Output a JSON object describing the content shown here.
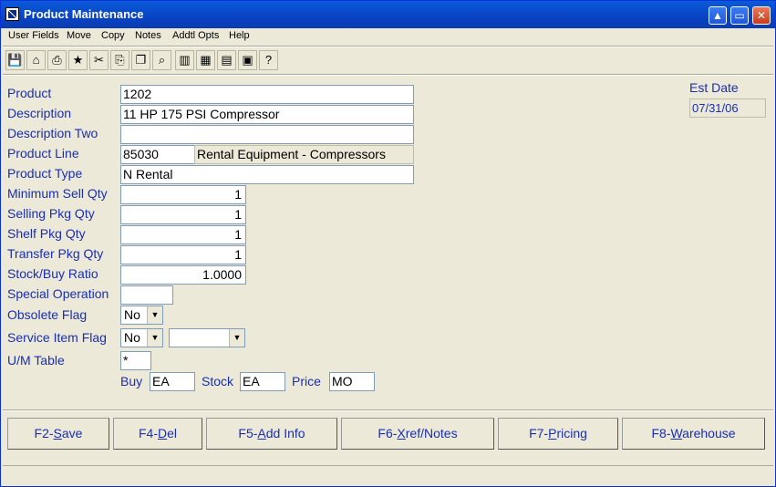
{
  "window": {
    "title": "Product Maintenance",
    "min_label": "▲",
    "max_label": "▭",
    "close_label": "✕"
  },
  "menu": [
    "User Fields",
    "Move",
    "Copy",
    "Notes",
    "Addtl Opts",
    "Help"
  ],
  "toolbar": [
    {
      "name": "save-icon",
      "glyph": "💾"
    },
    {
      "name": "clear-icon",
      "glyph": "⌂"
    },
    {
      "name": "print-icon",
      "glyph": "⎙"
    },
    {
      "name": "run-icon",
      "glyph": "★"
    },
    {
      "name": "cut-icon",
      "glyph": "✂"
    },
    {
      "name": "copy-icon",
      "glyph": "⎘"
    },
    {
      "name": "paste-icon",
      "glyph": "❐"
    },
    {
      "name": "find-icon",
      "glyph": "⌕"
    },
    {
      "name": "exit-door-icon",
      "glyph": "▥"
    },
    {
      "name": "bldg-icon",
      "glyph": "▦"
    },
    {
      "name": "calculator-icon",
      "glyph": "▤"
    },
    {
      "name": "calendar-icon",
      "glyph": "▣"
    },
    {
      "name": "help-icon",
      "glyph": "?"
    }
  ],
  "form": {
    "product": {
      "label": "Product",
      "value": "1202"
    },
    "description": {
      "label": "Description",
      "value": "11 HP 175 PSI Compressor"
    },
    "description_two": {
      "label": "Description Two",
      "value": ""
    },
    "product_line": {
      "label": "Product Line",
      "code": "85030",
      "name": "Rental Equipment - Compressors"
    },
    "product_type": {
      "label": "Product Type",
      "value": "N Rental"
    },
    "min_sell_qty": {
      "label": "Minimum Sell Qty",
      "value": "1"
    },
    "selling_pkg_qty": {
      "label": "Selling Pkg Qty",
      "value": "1"
    },
    "shelf_pkg_qty": {
      "label": "Shelf Pkg Qty",
      "value": "1"
    },
    "transfer_pkg_qty": {
      "label": "Transfer Pkg Qty",
      "value": "1"
    },
    "stock_buy_ratio": {
      "label": "Stock/Buy Ratio",
      "value": "1.0000"
    },
    "special_operation": {
      "label": "Special Operation",
      "value": ""
    },
    "obsolete_flag": {
      "label": "Obsolete Flag",
      "value": "No"
    },
    "service_item_flag": {
      "label": "Service Item Flag",
      "value": "No",
      "second_value": ""
    },
    "um_table": {
      "label": "U/M Table",
      "value": "*"
    },
    "buy": {
      "label": "Buy",
      "value": "EA"
    },
    "stock": {
      "label": "Stock",
      "value": "EA"
    },
    "price": {
      "label": "Price",
      "value": "MO"
    },
    "est_date": {
      "label": "Est Date",
      "value": "07/31/06"
    }
  },
  "buttons": {
    "save": {
      "key": "F2-",
      "u": "S",
      "rest": "ave"
    },
    "del": {
      "key": "F4-",
      "u": "D",
      "rest": "el"
    },
    "add_info": {
      "key": "F5-",
      "u": "A",
      "rest": "dd Info"
    },
    "xref": {
      "key": "F6-",
      "u": "X",
      "rest": "ref/Notes"
    },
    "pricing": {
      "key": "F7-",
      "u": "P",
      "rest": "ricing"
    },
    "warehouse": {
      "key": "F8-",
      "u": "W",
      "rest": "arehouse"
    }
  }
}
